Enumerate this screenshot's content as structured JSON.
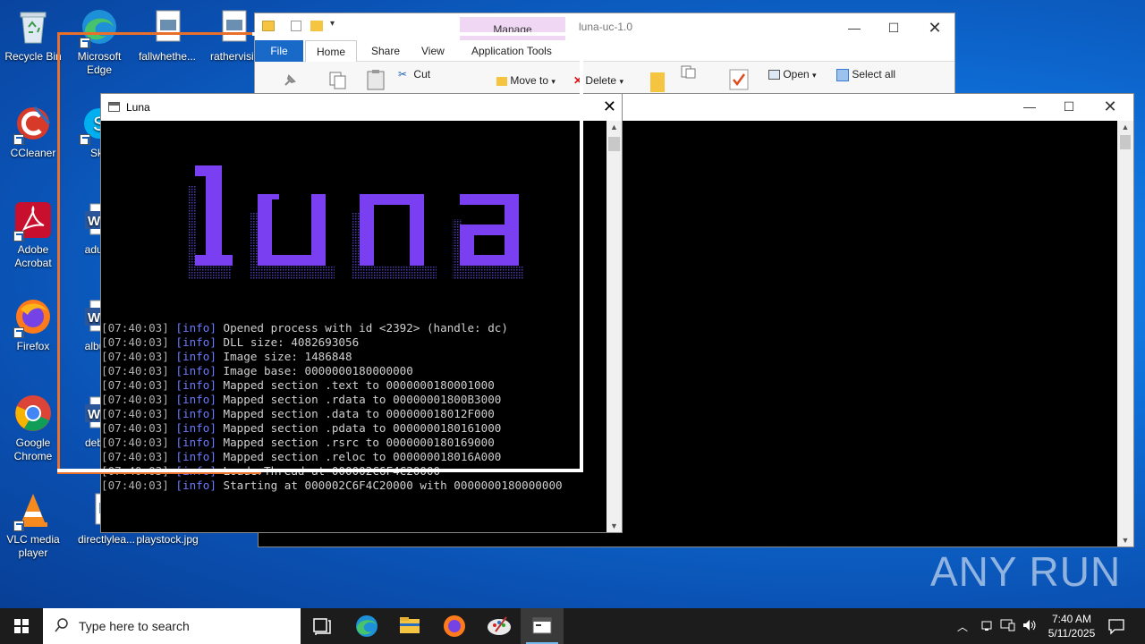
{
  "desktop": {
    "icons": [
      {
        "label": "Recycle Bin"
      },
      {
        "label": "Microsoft Edge"
      },
      {
        "label": "fallwhethe..."
      },
      {
        "label": "rathervisit"
      },
      {
        "label": "CCleaner"
      },
      {
        "label": "Sky"
      },
      {
        "label": "Adobe Acrobat"
      },
      {
        "label": "adulta"
      },
      {
        "label": "Firefox"
      },
      {
        "label": "album"
      },
      {
        "label": "Google Chrome"
      },
      {
        "label": "debtw"
      },
      {
        "label": "VLC media player"
      },
      {
        "label": "directlylea..."
      },
      {
        "label": "playstock.jpg"
      }
    ]
  },
  "explorer": {
    "title": "luna-uc-1.0",
    "manage_label": "Manage",
    "tabs": [
      "File",
      "Home",
      "Share",
      "View",
      "Application Tools"
    ],
    "ribbon": {
      "cut": "Cut",
      "move_to": "Move to",
      "delete": "Delete",
      "open": "Open",
      "select_all": "Select all"
    },
    "help": "?"
  },
  "luna": {
    "title": "Luna",
    "logo_text": "luna",
    "log": [
      {
        "ts": "[07:40:03]",
        "lv": "[info]",
        "msg": "Opened process with id <2392> (handle: dc)"
      },
      {
        "ts": "[07:40:03]",
        "lv": "[info]",
        "msg": "DLL size: 4082693056"
      },
      {
        "ts": "[07:40:03]",
        "lv": "[info]",
        "msg": "Image size: 1486848"
      },
      {
        "ts": "[07:40:03]",
        "lv": "[info]",
        "msg": "Image base: 0000000180000000"
      },
      {
        "ts": "[07:40:03]",
        "lv": "[info]",
        "msg": "Mapped section .text to 0000000180001000"
      },
      {
        "ts": "[07:40:03]",
        "lv": "[info]",
        "msg": "Mapped section .rdata to 00000001800B3000"
      },
      {
        "ts": "[07:40:03]",
        "lv": "[info]",
        "msg": "Mapped section .data to 000000018012F000"
      },
      {
        "ts": "[07:40:03]",
        "lv": "[info]",
        "msg": "Mapped section .pdata to 0000000180161000"
      },
      {
        "ts": "[07:40:03]",
        "lv": "[info]",
        "msg": "Mapped section .rsrc to 0000000180169000"
      },
      {
        "ts": "[07:40:03]",
        "lv": "[info]",
        "msg": "Mapped section .reloc to 000000018016A000"
      },
      {
        "ts": "[07:40:03]",
        "lv": "[info]",
        "msg": "LoaderThread at 000002C6F4C20000"
      },
      {
        "ts": "[07:40:03]",
        "lv": "[info]",
        "msg": "Starting at 000002C6F4C20000 with 0000000180000000"
      }
    ]
  },
  "watermark": "ANY RUN",
  "taskbar": {
    "search_placeholder": "Type here to search",
    "time": "7:40 AM",
    "date": "5/11/2025"
  },
  "colors": {
    "accent_orange": "#e8702a",
    "log_level": "#6b7bff",
    "logo_purple": "#7b3ff2"
  }
}
